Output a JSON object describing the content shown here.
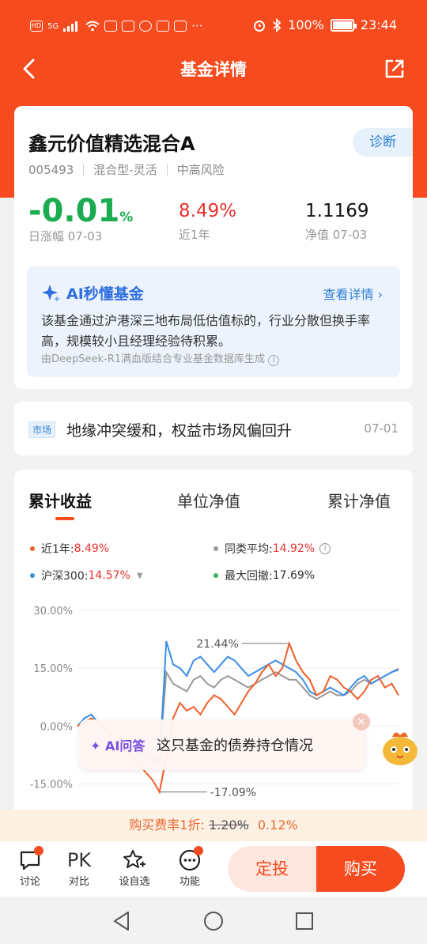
{
  "status_bar": {
    "network": "HD",
    "signal": "5G",
    "battery": "100%",
    "time": "23:44"
  },
  "nav": {
    "title": "基金详情"
  },
  "fund": {
    "name": "鑫元价值精选混合A",
    "diagnose_label": "诊断",
    "code": "005493",
    "type": "混合型-灵活",
    "risk": "中高风险",
    "daily_change": "-0.01",
    "daily_change_unit": "%",
    "daily_label": "日涨幅 07-03",
    "year_return": "8.49%",
    "year_label": "近1年",
    "nav_value": "1.1169",
    "nav_label": "净值 07-03"
  },
  "ai_summary": {
    "title": "AI秒懂基金",
    "more": "查看详情",
    "text": "该基金通过沪港深三地布局低估值标的，行业分散但换手率高，规模较小且经理经验待积累。",
    "source": "由DeepSeek-R1满血版结合专业基金数据库生成"
  },
  "news": {
    "tag": "市场",
    "title": "地缘冲突缓和，权益市场风偏回升",
    "date": "07-01"
  },
  "chart_tabs": [
    "累计收益",
    "单位净值",
    "累计净值"
  ],
  "legend": {
    "year_label": "近1年:",
    "year_value": "8.49%",
    "peer_label": "同类平均:",
    "peer_value": "14.92%",
    "index_label": "沪深300:",
    "index_value": "14.57%",
    "drawdown_label": "最大回撤:",
    "drawdown_value": "17.69%"
  },
  "chart_data": {
    "type": "line",
    "ylim": [
      -20,
      30
    ],
    "yticks": [
      "30.00%",
      "15.00%",
      "0.00%",
      "-15.00%"
    ],
    "annotations": [
      "21.44%",
      "-17.09%"
    ],
    "series": [
      {
        "name": "近1年",
        "color": "#f0602a",
        "values": [
          0,
          1,
          2,
          1,
          0,
          -2,
          -4,
          -6,
          -8,
          -10,
          -12,
          -14,
          -17.09,
          -8,
          2,
          6,
          4,
          5,
          3,
          6,
          8,
          7,
          5,
          3,
          6,
          9,
          11,
          14,
          16,
          13,
          15,
          21.44,
          17,
          14,
          12,
          8,
          9,
          13,
          12,
          10,
          9,
          7,
          9,
          12,
          13,
          10,
          11,
          8
        ]
      },
      {
        "name": "沪深300",
        "color": "#3a8ee6",
        "values": [
          0,
          2,
          3,
          1,
          -1,
          -2,
          -4,
          -5,
          -6,
          -7,
          -8,
          -9,
          -10,
          22,
          16,
          15,
          13,
          17,
          18,
          16,
          14,
          16,
          18,
          17,
          15,
          13,
          14,
          15,
          16,
          17,
          16,
          15,
          14,
          12,
          9,
          8,
          9,
          10,
          9,
          8,
          10,
          12,
          13,
          11,
          12,
          13,
          14,
          14.57
        ]
      },
      {
        "name": "同类平均",
        "color": "#999999",
        "values": [
          0,
          1,
          2,
          1,
          -1,
          -2,
          -3,
          -4,
          -5,
          -6,
          -7,
          -8,
          -9,
          14,
          11,
          10,
          9,
          12,
          13,
          11,
          10,
          12,
          13,
          12,
          11,
          10,
          11,
          12,
          13,
          14,
          13,
          12,
          12,
          10,
          8,
          7,
          8,
          9,
          8,
          8,
          9,
          11,
          12,
          11,
          12,
          13,
          14,
          14.92
        ]
      }
    ]
  },
  "ai_popup": {
    "tag": "AI问答",
    "question": "这只基金的债券持仓情况"
  },
  "fee": {
    "label": "购买费率1折:",
    "old_rate": "1.20%",
    "new_rate": "0.12%"
  },
  "bottom_bar": {
    "discuss": "讨论",
    "compare_icon": "PK",
    "compare": "对比",
    "watch": "设自选",
    "functions": "功能",
    "fixed_invest": "定投",
    "buy": "购买"
  }
}
